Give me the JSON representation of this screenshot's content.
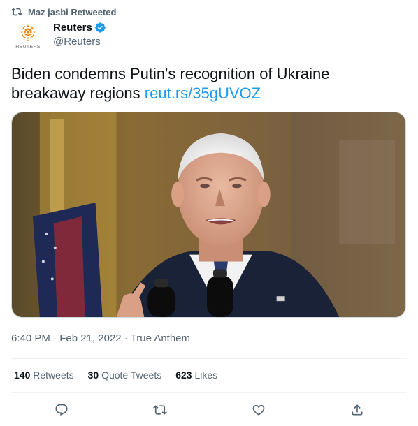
{
  "social_context": {
    "text": "Maz jasbi Retweeted",
    "icon": "retweet-icon"
  },
  "author": {
    "display_name": "Reuters",
    "handle": "@Reuters",
    "avatar_wordmark": "REUTERS",
    "verified_icon": "verified-badge-icon",
    "brand_color": "#ff8000"
  },
  "tweet": {
    "text": "Biden condemns Putin's recognition of Ukraine breakaway regions",
    "link": "reut.rs/35gUVOZ",
    "link_color": "#1d9bf0"
  },
  "media": {
    "icon": "photo-media"
  },
  "meta": {
    "time": "6:40 PM",
    "date": "Feb 21, 2022",
    "source": "True Anthem",
    "separator": "·"
  },
  "stats": [
    {
      "count": "140",
      "label": "Retweets"
    },
    {
      "count": "30",
      "label": "Quote Tweets"
    },
    {
      "count": "623",
      "label": "Likes"
    }
  ],
  "actions": [
    {
      "name": "reply",
      "icon": "reply-icon"
    },
    {
      "name": "retweet",
      "icon": "retweet-icon"
    },
    {
      "name": "like",
      "icon": "heart-icon"
    },
    {
      "name": "share",
      "icon": "share-icon"
    }
  ]
}
